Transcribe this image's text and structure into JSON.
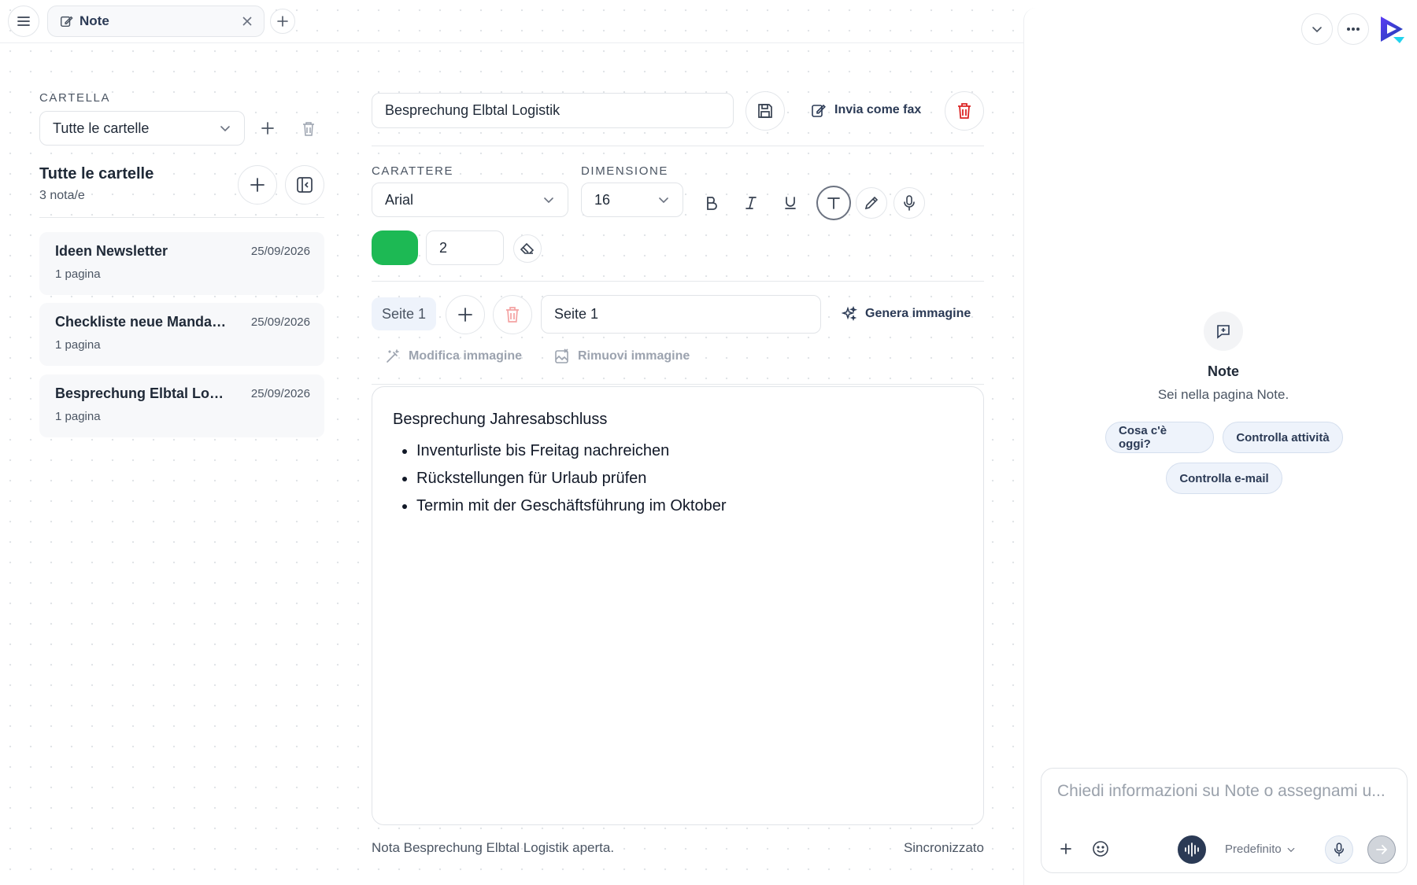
{
  "tabs": [
    {
      "label": "Note",
      "icon": "edit-note-icon"
    }
  ],
  "left": {
    "folder_label": "CARTELLA",
    "folder_select": "Tutte le cartelle",
    "list_title": "Tutte le cartelle",
    "list_count": "3 nota/e",
    "notes": [
      {
        "title": "Ideen Newsletter",
        "date": "25/09/2026",
        "pages": "1 pagina"
      },
      {
        "title": "Checkliste neue Mandan...",
        "date": "25/09/2026",
        "pages": "1 pagina"
      },
      {
        "title": "Besprechung Elbtal Logi...",
        "date": "25/09/2026",
        "pages": "1 pagina"
      }
    ]
  },
  "editor": {
    "title_value": "Besprechung Elbtal Logistik",
    "fax_label": "Invia come fax",
    "font_label": "CARATTERE",
    "font_value": "Arial",
    "size_label": "DIMENSIONE",
    "size_value": "16",
    "pen_color": "#1db954",
    "stroke_value": "2",
    "page_chip": "Seite 1",
    "page_name_value": "Seite 1",
    "generate_label": "Genera immagine",
    "edit_image_label": "Modifica immagine",
    "remove_image_label": "Rimuovi immagine",
    "content_heading": "Besprechung Jahresabschluss",
    "content_items": [
      "Inventurliste bis Freitag nachreichen",
      "Rückstellungen für Urlaub prüfen",
      "Termin mit der Geschäftsführung im Oktober"
    ],
    "status_left": "Nota Besprechung Elbtal Logistik aperta.",
    "status_right": "Sincronizzato"
  },
  "assistant": {
    "title": "Note",
    "subtitle": "Sei nella pagina Note.",
    "chips": [
      "Cosa c'è oggi?",
      "Controlla attività",
      "Controlla e-mail"
    ],
    "input_placeholder": "Chiedi informazioni su Note o assegnami u...",
    "mode_label": "Predefinito"
  },
  "colors": {
    "accent": "#2b3a55",
    "danger": "#dc2626",
    "pen": "#1db954"
  }
}
